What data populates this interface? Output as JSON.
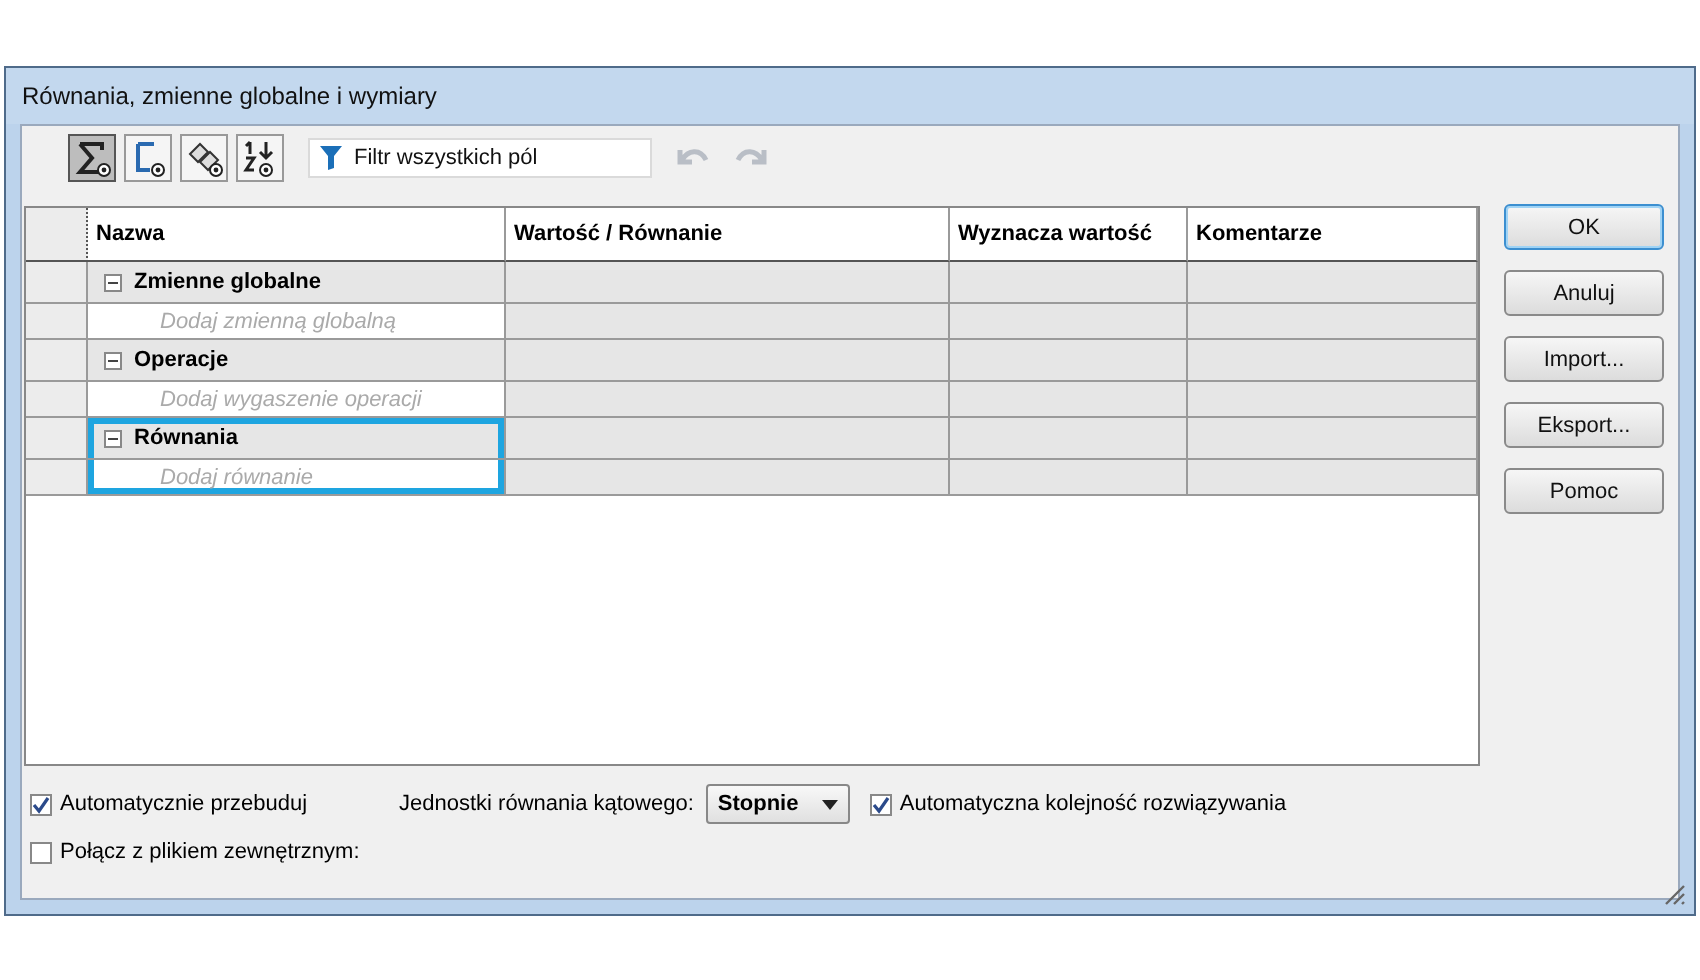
{
  "window": {
    "title": "Równania, zmienne globalne i wymiary"
  },
  "toolbar": {
    "view_buttons": [
      {
        "kind": "sigma",
        "selected": true
      },
      {
        "kind": "bracket",
        "selected": false
      },
      {
        "kind": "tags",
        "selected": false
      },
      {
        "kind": "order",
        "selected": false
      }
    ],
    "filter": {
      "placeholder": "Filtr wszystkich pól"
    }
  },
  "table": {
    "columns": [
      "Nazwa",
      "Wartość / Równanie",
      "Wyznacza wartość",
      "Komentarze"
    ],
    "groups": [
      {
        "title": "Zmienne globalne",
        "expanded": true,
        "highlighted": false,
        "add_hint": "Dodaj zmienną globalną"
      },
      {
        "title": "Operacje",
        "expanded": true,
        "highlighted": false,
        "add_hint": "Dodaj wygaszenie operacji"
      },
      {
        "title": "Równania",
        "expanded": true,
        "highlighted": true,
        "add_hint": "Dodaj równanie"
      }
    ]
  },
  "buttons": [
    {
      "label": "OK",
      "default": true
    },
    {
      "label": "Anuluj",
      "default": false
    },
    {
      "label": "Import...",
      "default": false
    },
    {
      "label": "Eksport...",
      "default": false
    },
    {
      "label": "Pomoc",
      "default": false
    }
  ],
  "options": {
    "auto_rebuild": {
      "label": "Automatycznie przebuduj",
      "checked": true
    },
    "angle_units": {
      "label": "Jednostki równania kątowego:",
      "value": "Stopnie"
    },
    "auto_order": {
      "label": "Automatyczna kolejność rozwiązywania",
      "checked": true
    },
    "link_file": {
      "label": "Połącz z plikiem zewnętrznym:",
      "checked": false
    }
  }
}
